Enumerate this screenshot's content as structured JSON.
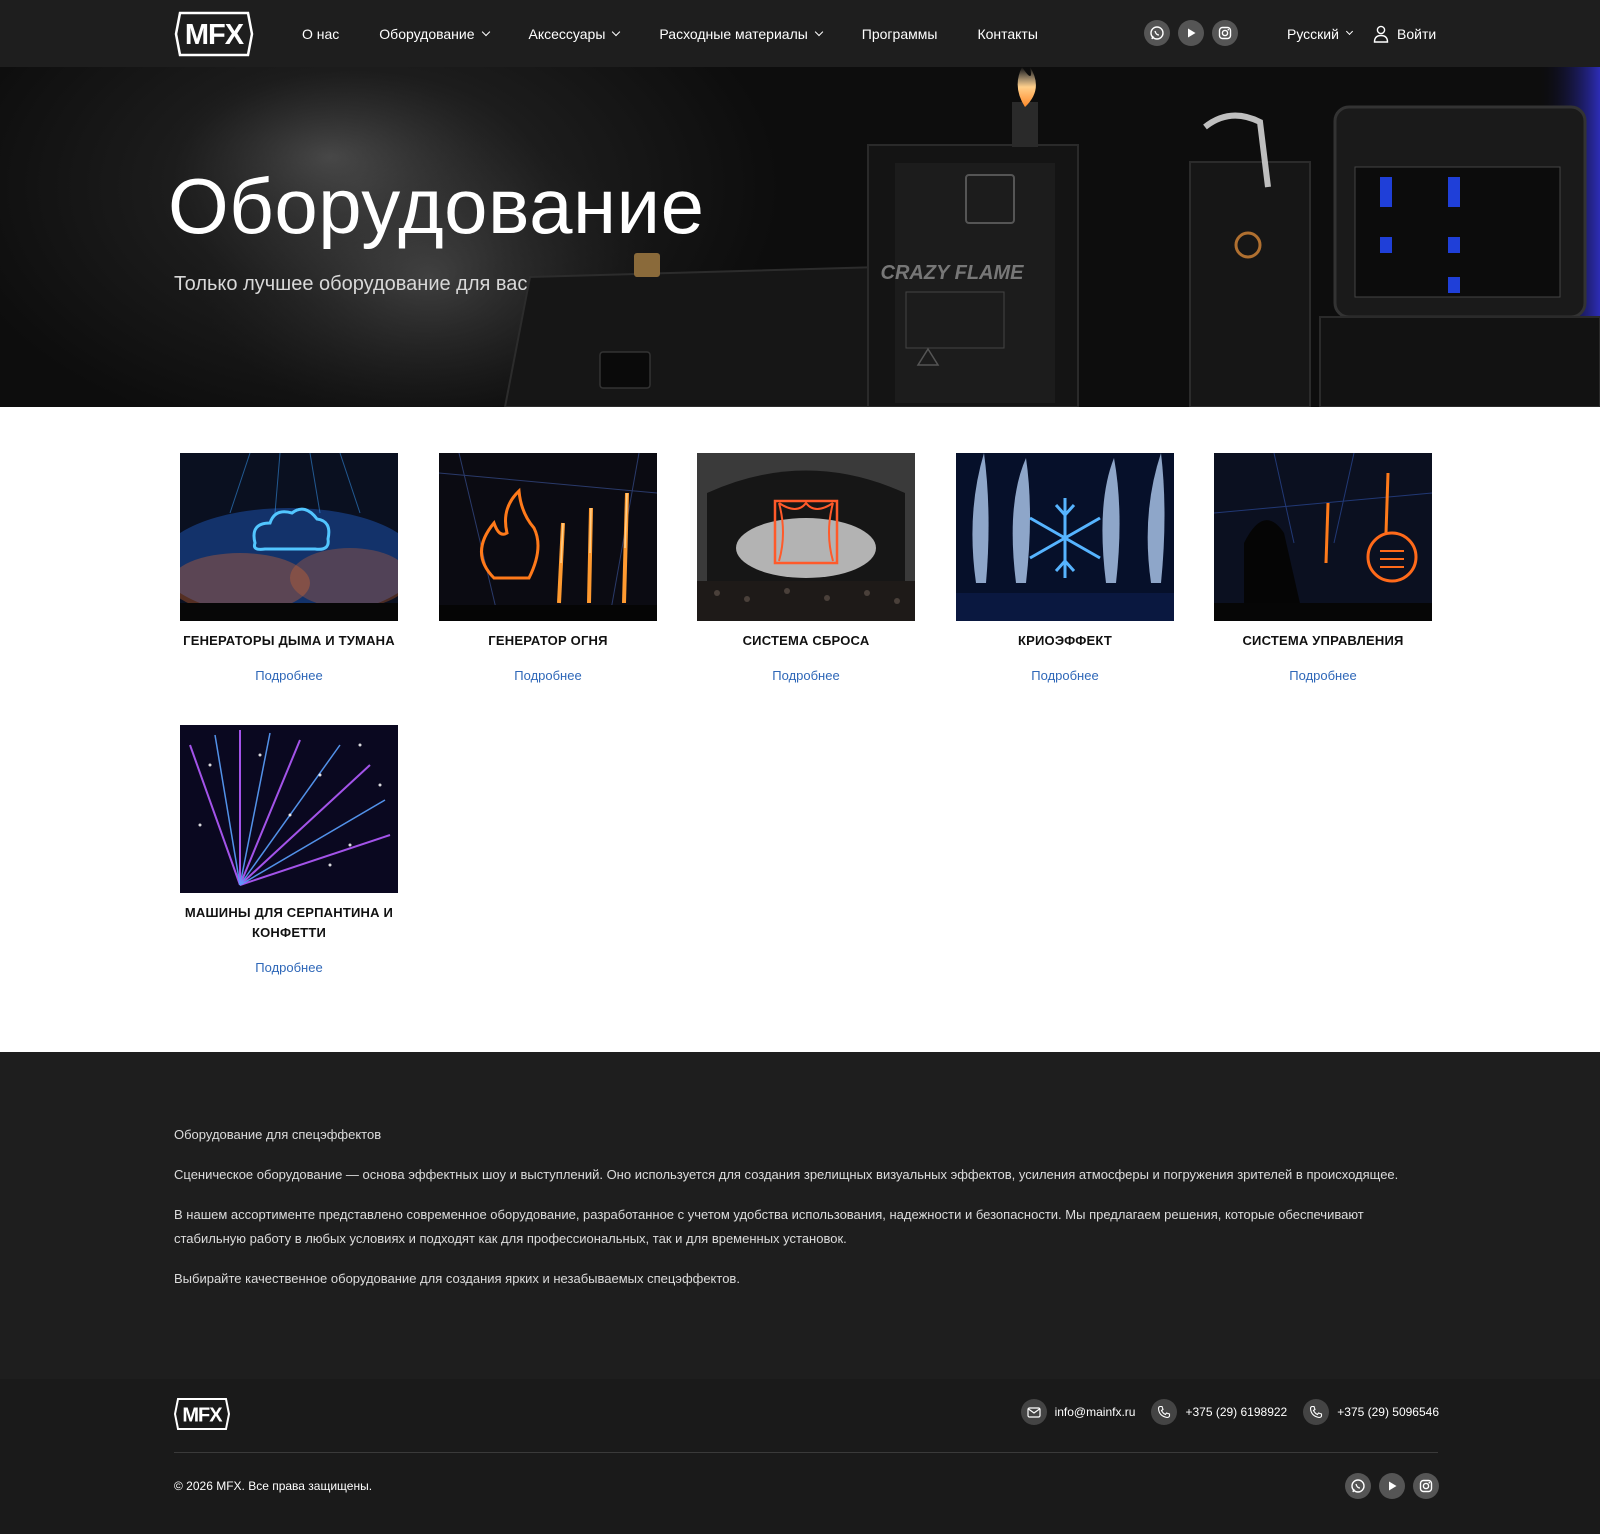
{
  "header": {
    "logo_text": "MFX",
    "nav": [
      {
        "label": "О нас",
        "has_dropdown": false
      },
      {
        "label": "Оборудование",
        "has_dropdown": true
      },
      {
        "label": "Аксессуары",
        "has_dropdown": true
      },
      {
        "label": "Расходные материалы",
        "has_dropdown": true
      },
      {
        "label": "Программы",
        "has_dropdown": false
      },
      {
        "label": "Контакты",
        "has_dropdown": false
      }
    ],
    "social_icons": [
      "whatsapp-icon",
      "youtube-icon",
      "instagram-icon"
    ],
    "language": "Русский",
    "login_label": "Войти"
  },
  "hero": {
    "title": "Оборудование",
    "subtitle": "Только лучшее оборудование для вас",
    "device_label": "CRAZY FLAME"
  },
  "categories": [
    {
      "title": "Генераторы дыма и тумана",
      "link": "Подробнее",
      "image": "smoke-cloud-neon"
    },
    {
      "title": "Генератор огня",
      "link": "Подробнее",
      "image": "fire-flame-neon"
    },
    {
      "title": "Система сброса",
      "link": "Подробнее",
      "image": "curtain-drop-neon"
    },
    {
      "title": "Криоэффект",
      "link": "Подробнее",
      "image": "snowflake-neon"
    },
    {
      "title": "Система управления",
      "link": "Подробнее",
      "image": "control-gear-neon"
    },
    {
      "title": "Машины для серпантина и конфетти",
      "link": "Подробнее",
      "image": "confetti-burst"
    }
  ],
  "seo": {
    "heading": "Оборудование для спецэффектов",
    "paragraphs": [
      "Сценическое оборудование — основа эффектных шоу и выступлений. Оно используется для создания зрелищных визуальных эффектов, усиления атмосферы и погружения зрителей в происходящее.",
      "В нашем ассортименте представлено современное оборудование, разработанное с учетом удобства использования, надежности и безопасности. Мы предлагаем решения, которые обеспечивают стабильную работу в любых условиях и подходят как для профессиональных, так и для временных установок.",
      "Выбирайте качественное оборудование для создания ярких и незабываемых спецэффектов."
    ]
  },
  "footer": {
    "logo_text": "MFX",
    "email": "info@mainfx.ru",
    "phones": [
      "+375 (29) 6198922",
      "+375 (29) 5096546"
    ],
    "copyright": "© 2026 MFX. Все права защищены.",
    "social_icons": [
      "whatsapp-icon",
      "youtube-icon",
      "instagram-icon"
    ]
  },
  "colors": {
    "header_bg": "#1e1e1e",
    "link_blue": "#2e67b8",
    "footer_bg": "#1a1a1a"
  }
}
